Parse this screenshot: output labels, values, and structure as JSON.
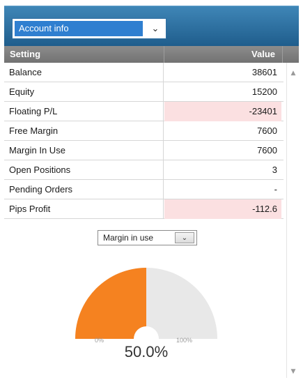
{
  "panel_selector": {
    "value": "Account info"
  },
  "table": {
    "headers": {
      "setting": "Setting",
      "value": "Value"
    },
    "rows": [
      {
        "setting": "Balance",
        "value": "38601",
        "negative": false
      },
      {
        "setting": "Equity",
        "value": "15200",
        "negative": false
      },
      {
        "setting": "Floating P/L",
        "value": "-23401",
        "negative": true
      },
      {
        "setting": "Free Margin",
        "value": "7600",
        "negative": false
      },
      {
        "setting": "Margin In Use",
        "value": "7600",
        "negative": false
      },
      {
        "setting": "Open Positions",
        "value": "3",
        "negative": false
      },
      {
        "setting": "Pending Orders",
        "value": "-",
        "negative": false
      },
      {
        "setting": "Pips Profit",
        "value": "-112.6",
        "negative": true
      }
    ]
  },
  "gauge": {
    "selector_value": "Margin in use",
    "min_label": "0%",
    "max_label": "100%",
    "value_label": "50.0%",
    "fraction": 0.5,
    "fill_color": "#f58220",
    "track_color": "#e8e8e8"
  },
  "colors": {
    "header_bar": "#2f6fa3",
    "negative_cell_bg": "#fbe0e1"
  }
}
